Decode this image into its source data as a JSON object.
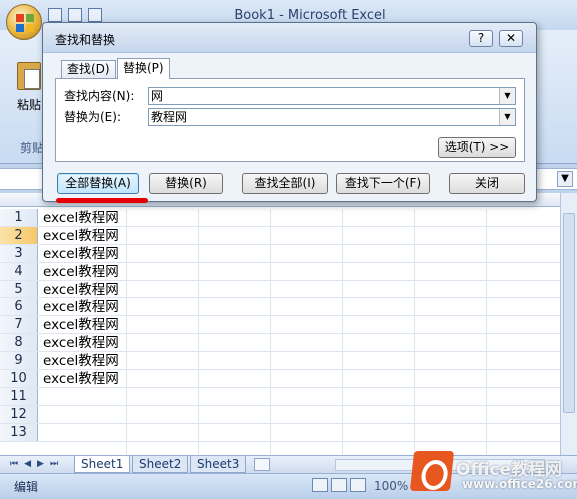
{
  "excel": {
    "window_title": "Book1 - Microsoft Excel",
    "ribbon_paste_label": "粘贴",
    "ribbon_group_label": "剪贴",
    "status": "编辑",
    "zoom": "100%"
  },
  "sheet": {
    "rows": [
      {
        "num": "1",
        "a": "excel教程网"
      },
      {
        "num": "2",
        "a": "excel教程网"
      },
      {
        "num": "3",
        "a": "excel教程网"
      },
      {
        "num": "4",
        "a": "excel教程网"
      },
      {
        "num": "5",
        "a": "excel教程网"
      },
      {
        "num": "6",
        "a": "excel教程网"
      },
      {
        "num": "7",
        "a": "excel教程网"
      },
      {
        "num": "8",
        "a": "excel教程网"
      },
      {
        "num": "9",
        "a": "excel教程网"
      },
      {
        "num": "10",
        "a": "excel教程网"
      },
      {
        "num": "11",
        "a": ""
      },
      {
        "num": "12",
        "a": ""
      },
      {
        "num": "13",
        "a": ""
      }
    ],
    "tabs": [
      "Sheet1",
      "Sheet2",
      "Sheet3"
    ],
    "nav": [
      "⏮",
      "◀",
      "▶",
      "⏭"
    ]
  },
  "dialog": {
    "title": "查找和替换",
    "help": "?",
    "close": "✕",
    "tab_find": "查找(D)",
    "tab_replace": "替换(P)",
    "find_label": "查找内容(N):",
    "find_value": "网",
    "replace_label": "替换为(E):",
    "replace_value": "教程网",
    "options_label": "选项(T) >>",
    "buttons": {
      "replace_all": "全部替换(A)",
      "replace": "替换(R)",
      "find_all": "查找全部(I)",
      "find_next": "查找下一个(F)",
      "close": "关闭"
    }
  },
  "watermark": {
    "title": "Office教程网",
    "url": "www.office26.com"
  }
}
